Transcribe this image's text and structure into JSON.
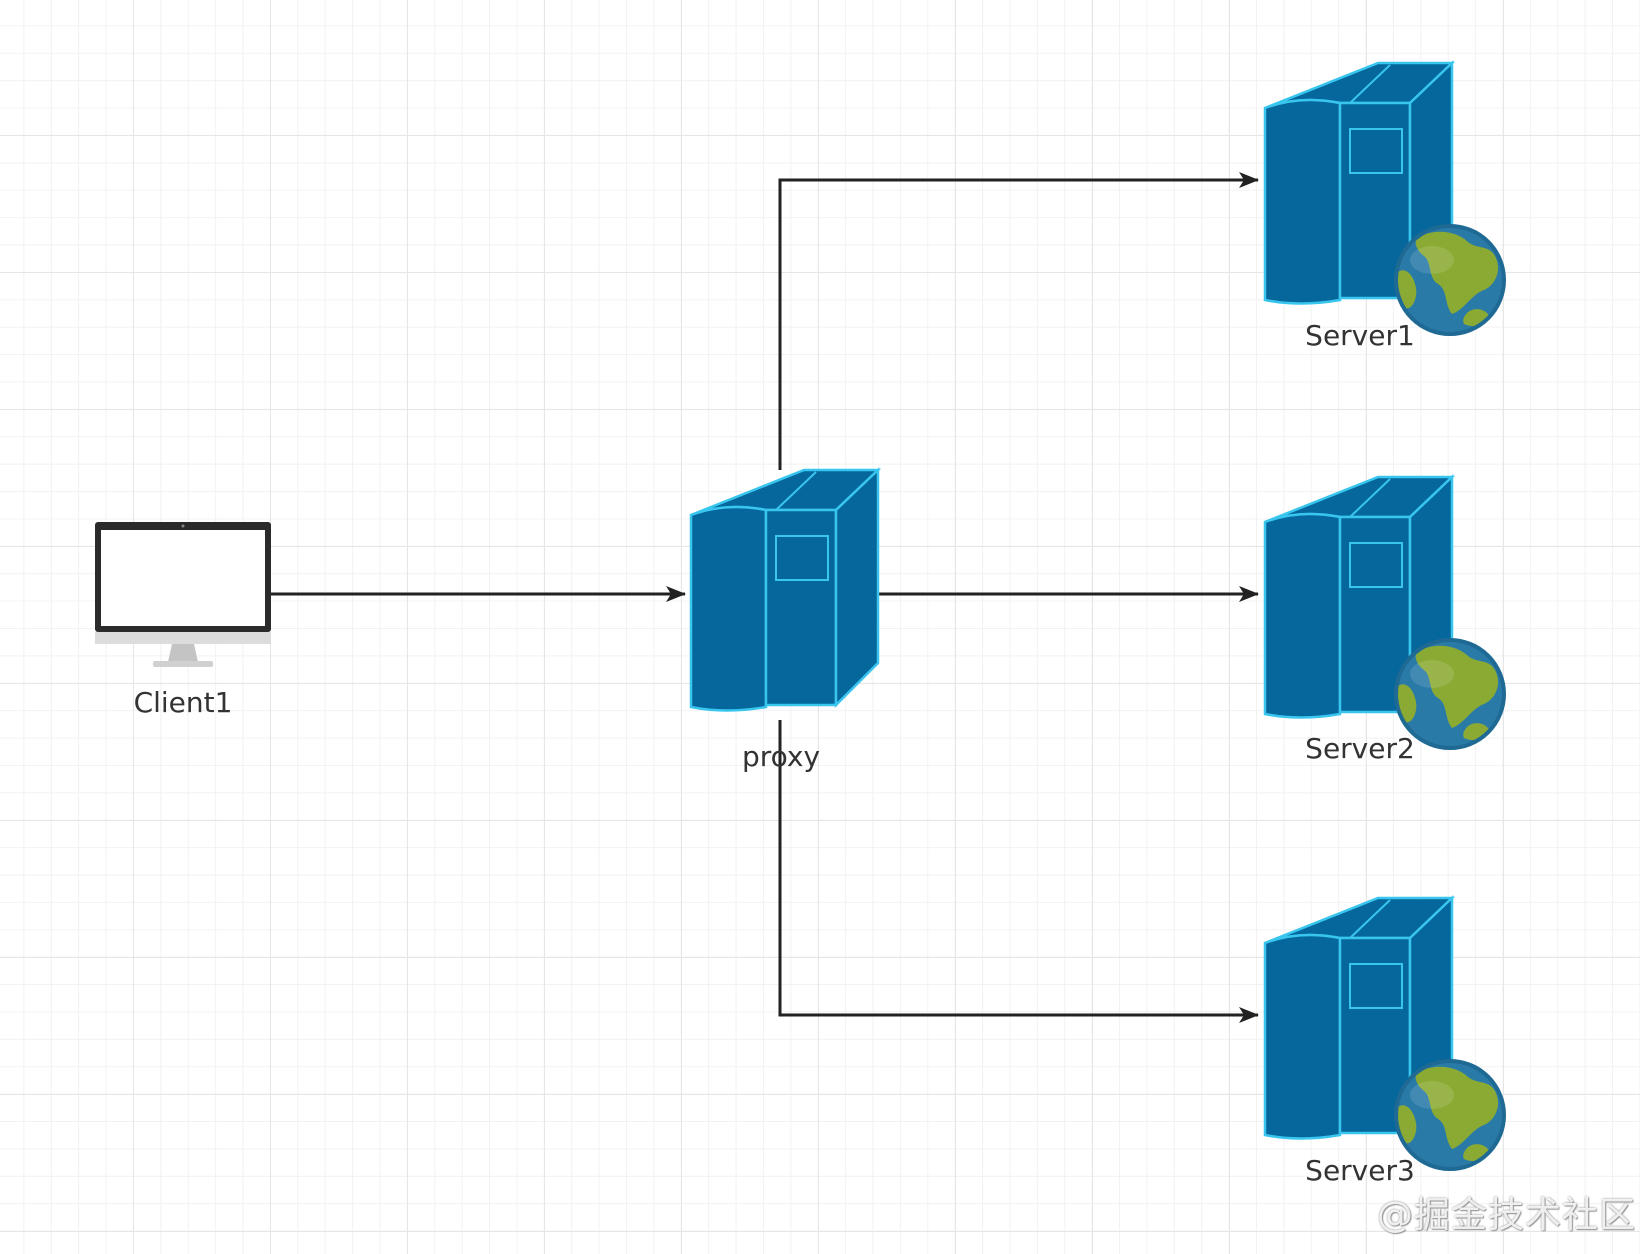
{
  "nodes": {
    "client": {
      "label": "Client1",
      "kind": "desktop-monitor"
    },
    "proxy": {
      "label": "proxy",
      "kind": "server-tower"
    },
    "servers": [
      {
        "label": "Server1",
        "kind": "web-server"
      },
      {
        "label": "Server2",
        "kind": "web-server"
      },
      {
        "label": "Server3",
        "kind": "web-server"
      }
    ]
  },
  "edges": [
    {
      "from": "Client1",
      "to": "proxy"
    },
    {
      "from": "proxy",
      "to": "Server1"
    },
    {
      "from": "proxy",
      "to": "Server2"
    },
    {
      "from": "proxy",
      "to": "Server3"
    }
  ],
  "watermark": "@掘金技术社区",
  "colors": {
    "server_body": "#05679c",
    "server_outline": "#38c5ee",
    "globe_ocean": "#2a7aa8",
    "globe_land": "#8aaa33",
    "edge": "#222222",
    "grid": "#e6e6e6"
  }
}
